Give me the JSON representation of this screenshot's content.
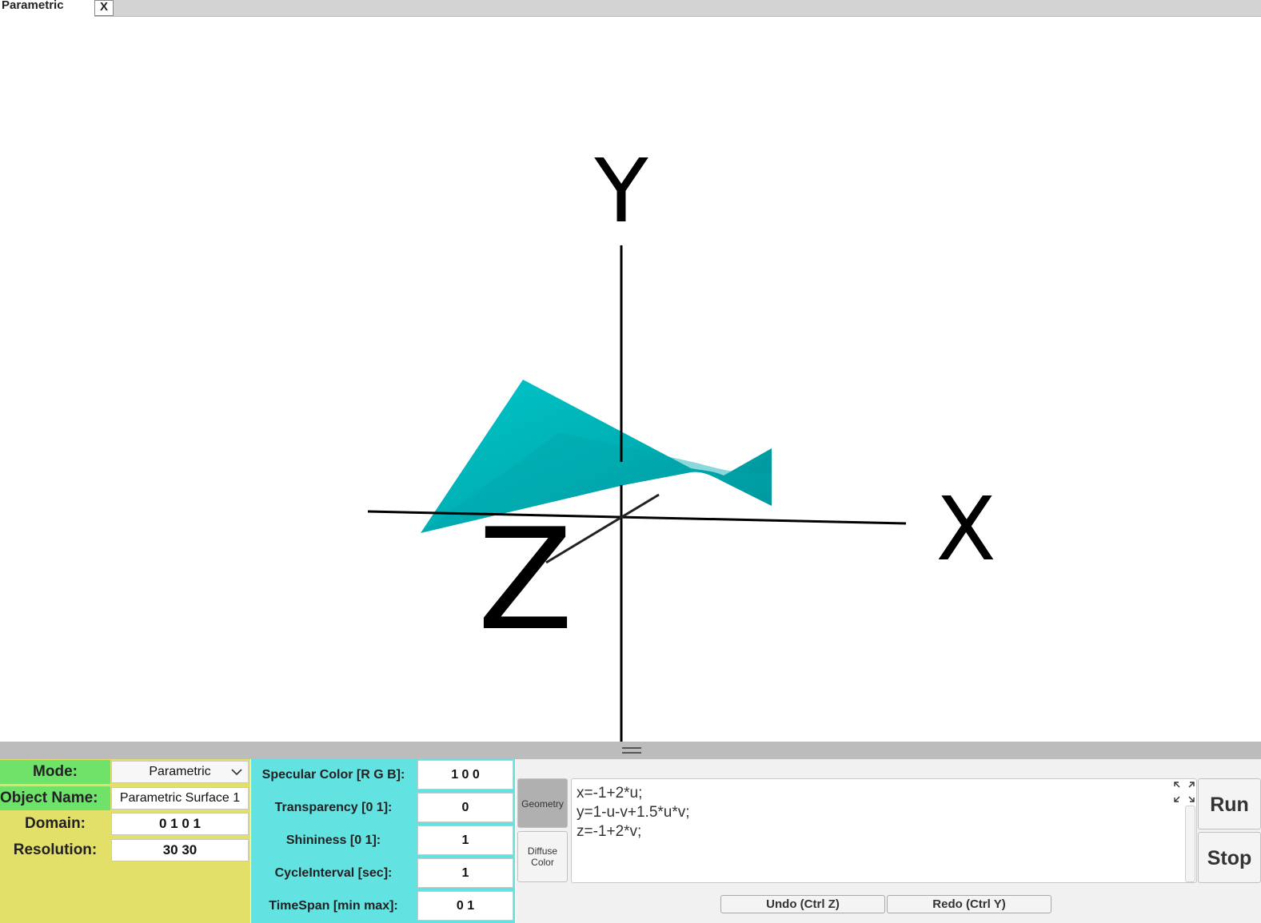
{
  "tab": {
    "title": "Parametric",
    "close_label": "X"
  },
  "viewport": {
    "axis_labels": {
      "x": "X",
      "y": "Y",
      "z": "Z"
    },
    "surface_color": "#00b7bd",
    "axis_color": "#000000"
  },
  "left_panel": {
    "mode": {
      "label": "Mode:",
      "value": "Parametric"
    },
    "object_name": {
      "label": "Object Name:",
      "value": "Parametric Surface 1"
    },
    "domain": {
      "label": "Domain:",
      "value": "0 1 0 1"
    },
    "resolution": {
      "label": "Resolution:",
      "value": "30 30"
    },
    "mode_color": "#6fe26a",
    "panel_color": "#e3e06a"
  },
  "mid_panel": {
    "color": "#63e2e2",
    "specular": {
      "label": "Specular Color [R G B]:",
      "value": "1 0 0"
    },
    "transparency": {
      "label": "Transparency [0 1]:",
      "value": "0"
    },
    "shininess": {
      "label": "Shininess [0 1]:",
      "value": "1"
    },
    "cycle_interval": {
      "label": "CycleInterval [sec]:",
      "value": "1"
    },
    "timespan": {
      "label": "TimeSpan [min max]:",
      "value": "0 1"
    }
  },
  "right_panel": {
    "geometry_label": "Geometry",
    "diffuse_label": "Diffuse Color",
    "code": "x=-1+2*u;\ny=1-u-v+1.5*u*v;\nz=-1+2*v;",
    "run_label": "Run",
    "stop_label": "Stop",
    "undo_label": "Undo (Ctrl Z)",
    "redo_label": "Redo (Ctrl Y)"
  }
}
